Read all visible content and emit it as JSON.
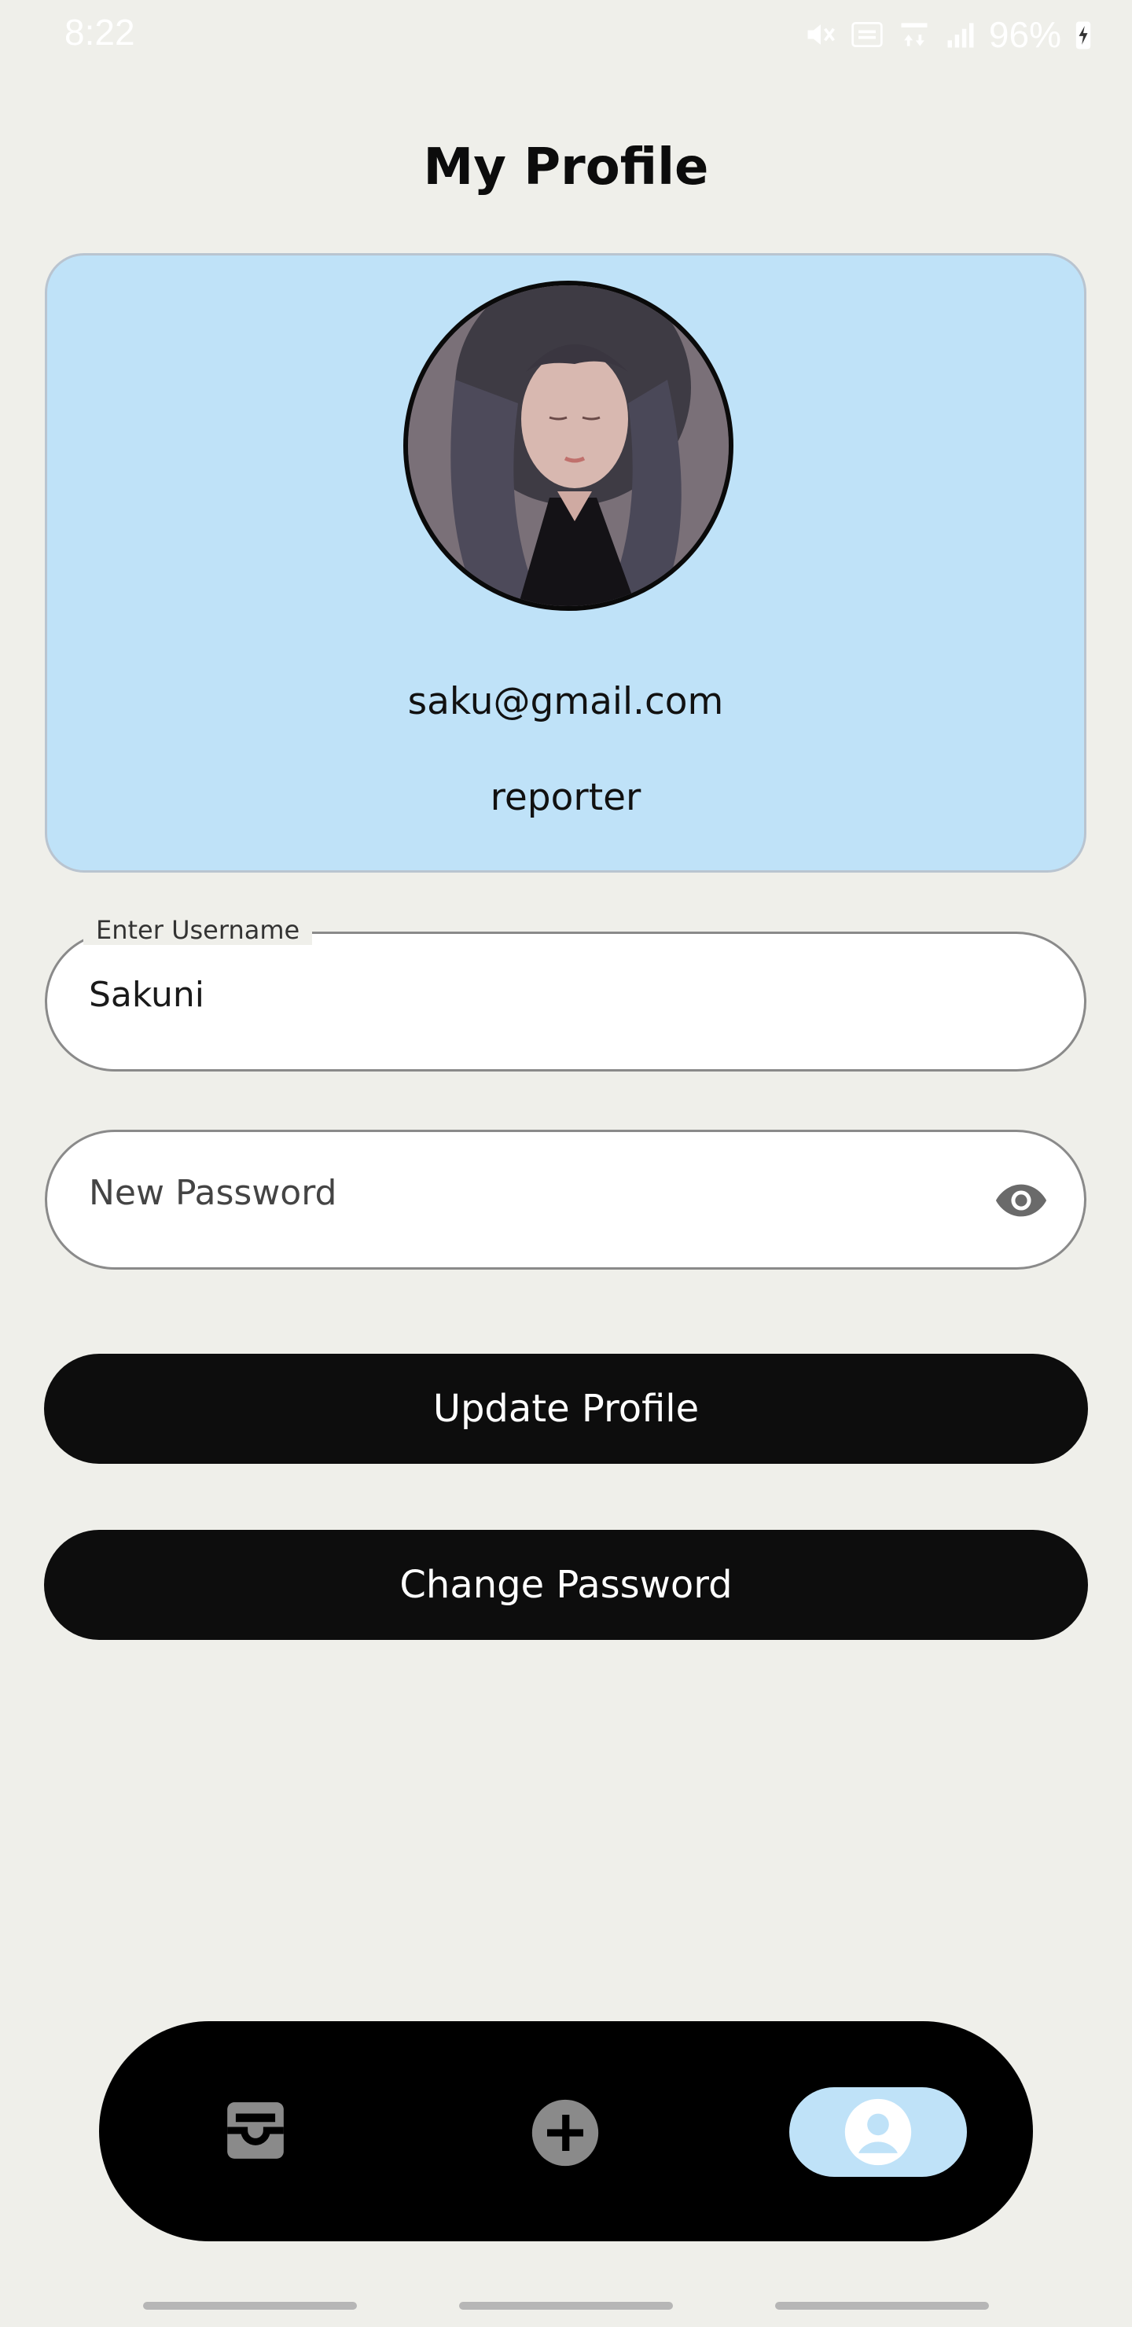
{
  "status_bar": {
    "time": "8:22",
    "battery": "96%"
  },
  "page": {
    "title": "My Profile"
  },
  "profile": {
    "email": "saku@gmail.com",
    "role": "reporter"
  },
  "form": {
    "username_label": "Enter Username",
    "username_value": "Sakuni",
    "password_placeholder": "New Password"
  },
  "buttons": {
    "update_profile": "Update Profile",
    "change_password": "Change Password"
  },
  "bottom_nav": {
    "items": [
      {
        "icon": "inbox-icon",
        "active": false
      },
      {
        "icon": "add-circle-icon",
        "active": false
      },
      {
        "icon": "profile-icon",
        "active": true
      }
    ]
  },
  "colors": {
    "background": "#efefea",
    "card": "#bfe2f8",
    "button": "#0d0d0d",
    "nav_bar": "#000000",
    "nav_active": "#bfe2f8"
  }
}
